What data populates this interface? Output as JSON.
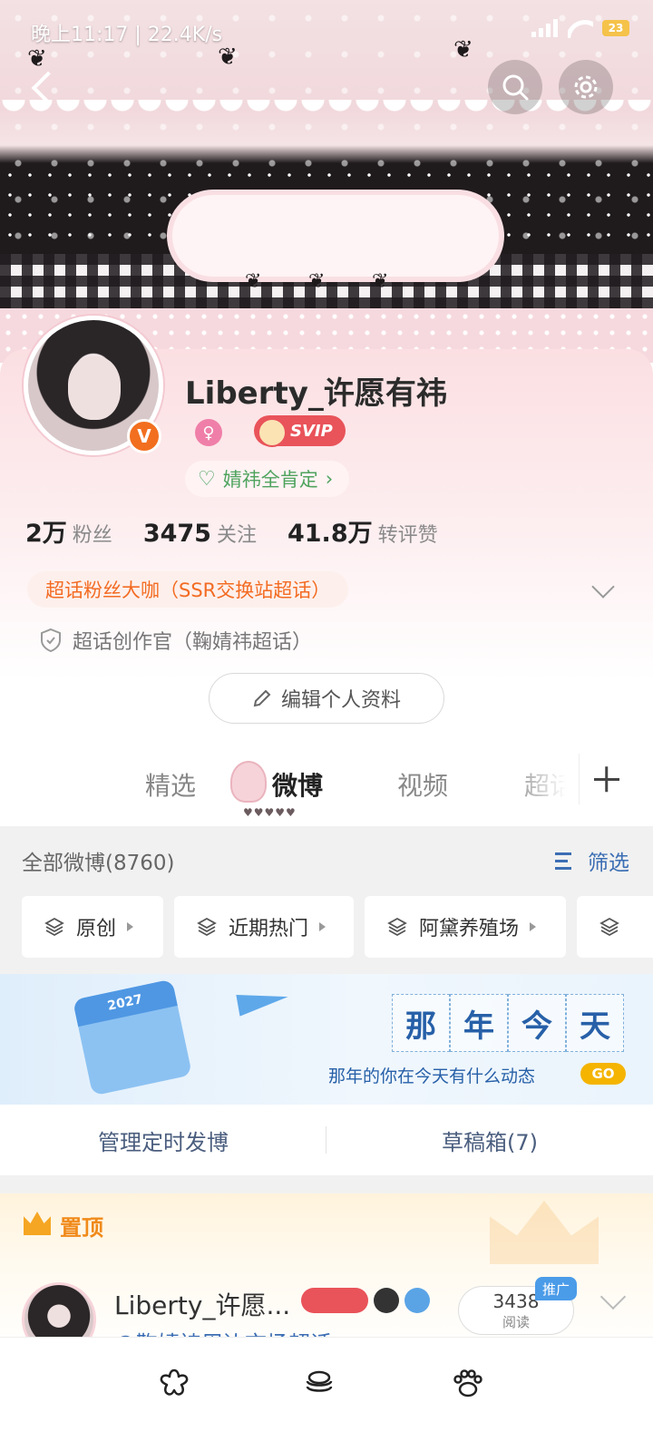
{
  "status_bar": {
    "time_text": "晚上11:17 | 22.4K/s",
    "battery_label": "23"
  },
  "profile": {
    "username": "Liberty_许愿有祎",
    "verified_badge": "V",
    "svip_badge": "SVIP",
    "fan_tag": "婧祎全肯定",
    "stats": [
      {
        "value": "2万",
        "label": "粉丝"
      },
      {
        "value": "3475",
        "label": "关注"
      },
      {
        "value": "41.8万",
        "label": "转评赞"
      }
    ],
    "ssr_tag": "超话粉丝大咖（SSR交换站超话）",
    "creator_text": "超话创作官（鞠婧祎超话）",
    "edit_button": "编辑个人资料"
  },
  "tabs": [
    {
      "label": "精选",
      "active": false
    },
    {
      "label": "微博",
      "active": true
    },
    {
      "label": "视频",
      "active": false
    },
    {
      "label": "超话",
      "active": false
    }
  ],
  "feed": {
    "all_posts": "全部微博(8760)",
    "filter_label": "筛选",
    "chips": [
      "原创",
      "近期热门",
      "阿黛养殖场"
    ],
    "memory_banner": {
      "calendar_year": "2027",
      "title_chars": [
        "那",
        "年",
        "今",
        "天"
      ],
      "subtitle": "那年的你在今天有什么动态",
      "go_label": "GO"
    },
    "manage_scheduled": "管理定时发博",
    "drafts": "草稿箱(7)",
    "pinned_label": "置顶",
    "pinned_post": {
      "author": "Liberty_许愿...",
      "subtitle": "@鞠婧祎周边市场超话",
      "read_count": "3438",
      "read_label": "阅读",
      "promo_tag": "推广"
    }
  },
  "colors": {
    "accent_orange": "#f36b22",
    "link_blue": "#3c6eb4",
    "fan_green": "#4ea35d",
    "pinned_orange": "#f08a1a"
  }
}
